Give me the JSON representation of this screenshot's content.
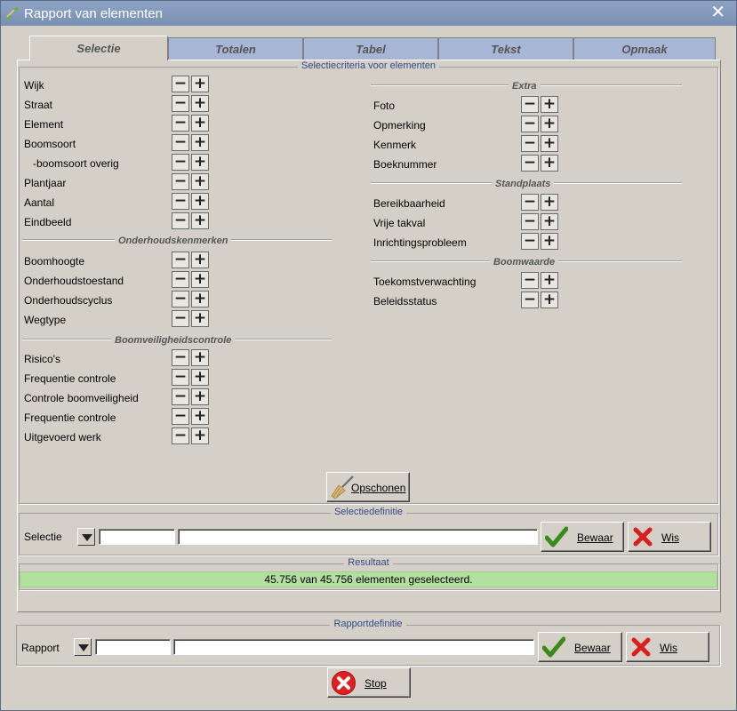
{
  "window": {
    "title": "Rapport van elementen",
    "close_glyph": "✕",
    "app_icon": "broom-app-icon"
  },
  "tabs": [
    {
      "label": "Selectie",
      "active": true
    },
    {
      "label": "Totalen",
      "active": false
    },
    {
      "label": "Tabel",
      "active": false
    },
    {
      "label": "Tekst",
      "active": false
    },
    {
      "label": "Opmaak",
      "active": false
    }
  ],
  "criteria": {
    "group_title": "Selectiecriteria voor elementen",
    "left": [
      {
        "label": "Wijk"
      },
      {
        "label": "Straat"
      },
      {
        "label": "Element"
      },
      {
        "label": "Boomsoort"
      },
      {
        "label": "-boomsoort overig"
      },
      {
        "label": "Plantjaar"
      },
      {
        "label": "Aantal"
      },
      {
        "label": "Eindbeeld"
      }
    ],
    "onderhoud_title": "Onderhoudskenmerken",
    "onderhoud": [
      {
        "label": "Boomhoogte"
      },
      {
        "label": "Onderhoudstoestand"
      },
      {
        "label": "Onderhoudscyclus"
      },
      {
        "label": "Wegtype"
      }
    ],
    "veiligheid_title": "Boomveiligheidscontrole",
    "veiligheid": [
      {
        "label": "Risico's"
      },
      {
        "label": "Frequentie controle"
      },
      {
        "label": "Controle boomveiligheid"
      },
      {
        "label": "Frequentie controle"
      },
      {
        "label": "Uitgevoerd werk"
      }
    ],
    "extra_title": "Extra",
    "extra": [
      {
        "label": "Foto"
      },
      {
        "label": "Opmerking"
      },
      {
        "label": "Kenmerk"
      },
      {
        "label": "Boeknummer"
      }
    ],
    "standplaats_title": "Standplaats",
    "standplaats": [
      {
        "label": "Bereikbaarheid"
      },
      {
        "label": "Vrije takval"
      },
      {
        "label": "Inrichtingsprobleem"
      }
    ],
    "boomwaarde_title": "Boomwaarde",
    "boomwaarde": [
      {
        "label": "Toekomstverwachting"
      },
      {
        "label": "Beleidsstatus"
      }
    ],
    "minus_glyph": "−",
    "plus_glyph": "+",
    "clean_button": "Opschonen"
  },
  "selectie": {
    "group_title": "Selectiedefinitie",
    "label": "Selectie",
    "code_value": "",
    "name_value": "",
    "save_button": "Bewaar",
    "clear_button": "Wis"
  },
  "resultaat": {
    "group_title": "Resultaat",
    "text": "45.756 van 45.756 elementen geselecteerd."
  },
  "rapport": {
    "group_title": "Rapportdefinitie",
    "label": "Rapport",
    "code_value": "",
    "name_value": "",
    "save_button": "Bewaar",
    "clear_button": "Wis"
  },
  "stop_button": "Stop",
  "colors": {
    "titlebar": "#7a90b3",
    "tab_inactive": "#a7b6d4",
    "result_bar": "#b3e0a0",
    "check_green": "#3a8a1a",
    "cross_red": "#d81e1e"
  }
}
